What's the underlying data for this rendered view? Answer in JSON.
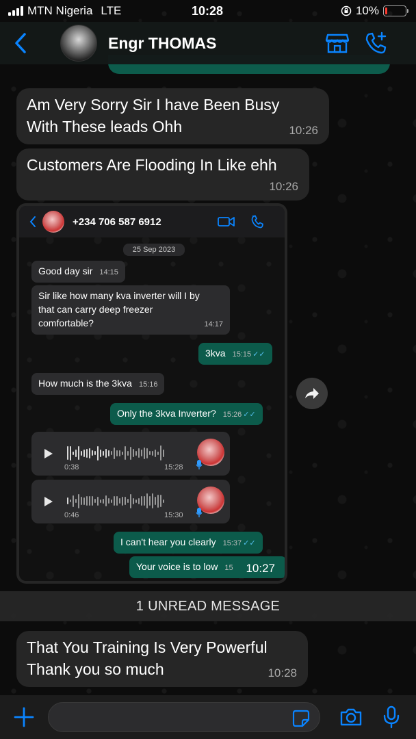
{
  "status_bar": {
    "carrier": "MTN Nigeria",
    "network": "LTE",
    "time": "10:28",
    "battery": "10%",
    "battery_level": 0.1
  },
  "header": {
    "contact_name": "Engr THOMAS",
    "icons": [
      "back-chevron-icon",
      "store-icon",
      "add-call-icon"
    ],
    "accent": "#0a84ff"
  },
  "messages": [
    {
      "text_line1": "Am Very Sorry Sir I have Been Busy",
      "text_line2": "With These leads Ohh",
      "time": "10:26"
    },
    {
      "text": "Customers Are Flooding In Like ehh",
      "time": "10:26"
    },
    {
      "type": "image",
      "time": "10:27"
    },
    {
      "text_line1": "That You Training Is Very Powerful",
      "text_line2": "Thank you so much",
      "time": "10:28"
    }
  ],
  "embedded": {
    "phone": "+234 706 587 6912",
    "date": "25 Sep 2023",
    "messages": [
      {
        "text": "Good day sir",
        "time": "14:15"
      },
      {
        "text_line1": "Sir like how many kva inverter will I by",
        "text_line2": "that can carry deep freezer",
        "text_line3": "comfortable?",
        "time": "14:17"
      },
      {
        "text": "3kva",
        "time": "15:15"
      },
      {
        "text": "How much is the 3kva",
        "time": "15:16"
      },
      {
        "text": "Only the 3kva Inverter?",
        "time": "15:26"
      },
      {
        "type": "voice",
        "duration": "0:38",
        "time": "15:28"
      },
      {
        "type": "voice",
        "duration": "0:46",
        "time": "15:30"
      },
      {
        "text": "I can't hear you clearly",
        "time": "15:37"
      },
      {
        "text": "Your voice is to low",
        "time": "15"
      }
    ]
  },
  "unread_banner": "1 UNREAD MESSAGE",
  "colors": {
    "outgoing": "#0c5b4b",
    "incoming": "#262626",
    "read_ticks": "#53bdeb"
  }
}
